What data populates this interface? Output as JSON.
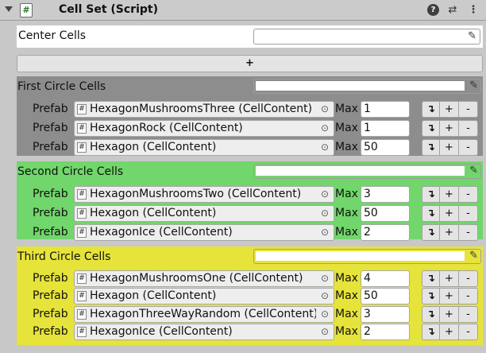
{
  "header": {
    "title": "Cell Set (Script)",
    "script_icon": "#",
    "help_icon": "?",
    "presets_icon": "⇄",
    "menu_icon": "⋮"
  },
  "center": {
    "label": "Center Cells",
    "value": ""
  },
  "add_button": "+",
  "labels": {
    "prefab": "Prefab",
    "max": "Max",
    "insert": "↴",
    "add": "+",
    "remove": "-",
    "picker": "✎",
    "target": "⊙",
    "component_icon": "#"
  },
  "colors": {
    "first_bg": "#8d8d8d",
    "second_bg": "#71d66b",
    "third_bg": "#e6e33a",
    "swatch": "#ffffff"
  },
  "sections": [
    {
      "title": "First Circle Cells",
      "rows": [
        {
          "prefab": "HexagonMushroomsThree (CellContent)",
          "max": "1"
        },
        {
          "prefab": "HexagonRock (CellContent)",
          "max": "1"
        },
        {
          "prefab": "Hexagon (CellContent)",
          "max": "50"
        }
      ]
    },
    {
      "title": "Second Circle Cells",
      "rows": [
        {
          "prefab": "HexagonMushroomsTwo (CellContent)",
          "max": "3"
        },
        {
          "prefab": "Hexagon (CellContent)",
          "max": "50"
        },
        {
          "prefab": "HexagonIce (CellContent)",
          "max": "2"
        }
      ]
    },
    {
      "title": "Third Circle Cells",
      "rows": [
        {
          "prefab": "HexagonMushroomsOne (CellContent)",
          "max": "4"
        },
        {
          "prefab": "Hexagon (CellContent)",
          "max": "50"
        },
        {
          "prefab": "HexagonThreeWayRandom (CellContent)",
          "max": "3"
        },
        {
          "prefab": "HexagonIce (CellContent)",
          "max": "2"
        }
      ]
    }
  ]
}
